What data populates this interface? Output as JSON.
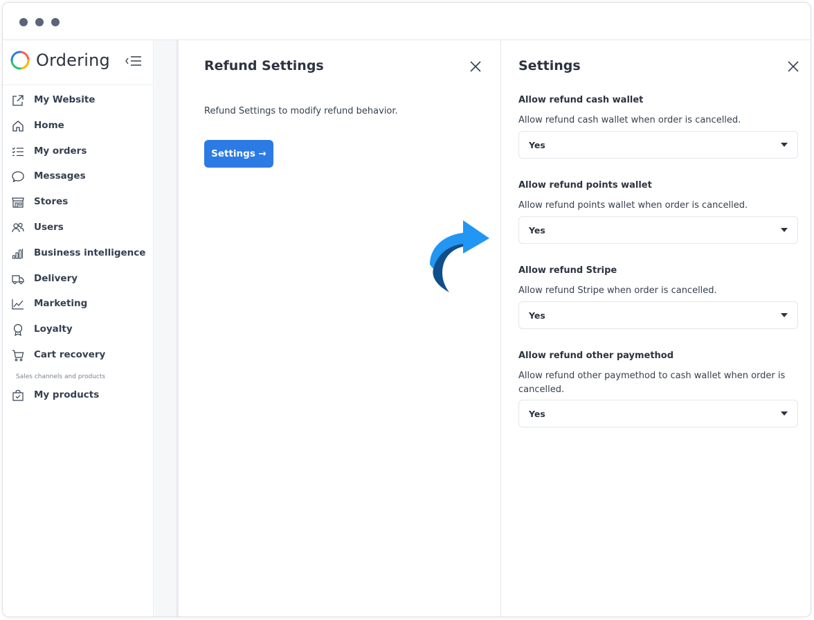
{
  "window": {
    "controls": [
      "dot-1",
      "dot-2",
      "dot-3"
    ]
  },
  "brand": {
    "name": "Ordering"
  },
  "sidebar": {
    "items": [
      {
        "label": "My Website",
        "icon": "external-link-icon"
      },
      {
        "label": "Home",
        "icon": "home-icon"
      },
      {
        "label": "My orders",
        "icon": "list-icon"
      },
      {
        "label": "Messages",
        "icon": "chat-icon"
      },
      {
        "label": "Stores",
        "icon": "store-icon"
      },
      {
        "label": "Users",
        "icon": "users-icon"
      },
      {
        "label": "Business intelligence",
        "icon": "bar-chart-icon"
      },
      {
        "label": "Delivery",
        "icon": "truck-icon"
      },
      {
        "label": "Marketing",
        "icon": "line-chart-icon"
      },
      {
        "label": "Loyalty",
        "icon": "award-icon"
      },
      {
        "label": "Cart recovery",
        "icon": "cart-icon"
      }
    ],
    "section_label": "Sales channels and products",
    "products": {
      "label": "My products",
      "icon": "shopping-bag-icon"
    }
  },
  "refund_panel": {
    "title": "Refund Settings",
    "description": "Refund Settings to modify refund behavior.",
    "button_label": "Settings →"
  },
  "settings_panel": {
    "title": "Settings",
    "options": [
      {
        "title": "Allow refund cash wallet",
        "description": "Allow refund cash wallet when order is cancelled.",
        "value": "Yes"
      },
      {
        "title": "Allow refund points wallet",
        "description": "Allow refund points wallet when order is cancelled.",
        "value": "Yes"
      },
      {
        "title": "Allow refund Stripe",
        "description": "Allow refund Stripe when order is cancelled.",
        "value": "Yes"
      },
      {
        "title": "Allow refund other paymethod",
        "description": "Allow refund other paymethod to cash wallet when order is cancelled.",
        "value": "Yes"
      }
    ]
  },
  "colors": {
    "primary": "#2c7be5",
    "arrow_light": "#2196f3",
    "arrow_dark": "#0d4f8b",
    "text": "#344050",
    "window_dots": "#5b6478"
  }
}
